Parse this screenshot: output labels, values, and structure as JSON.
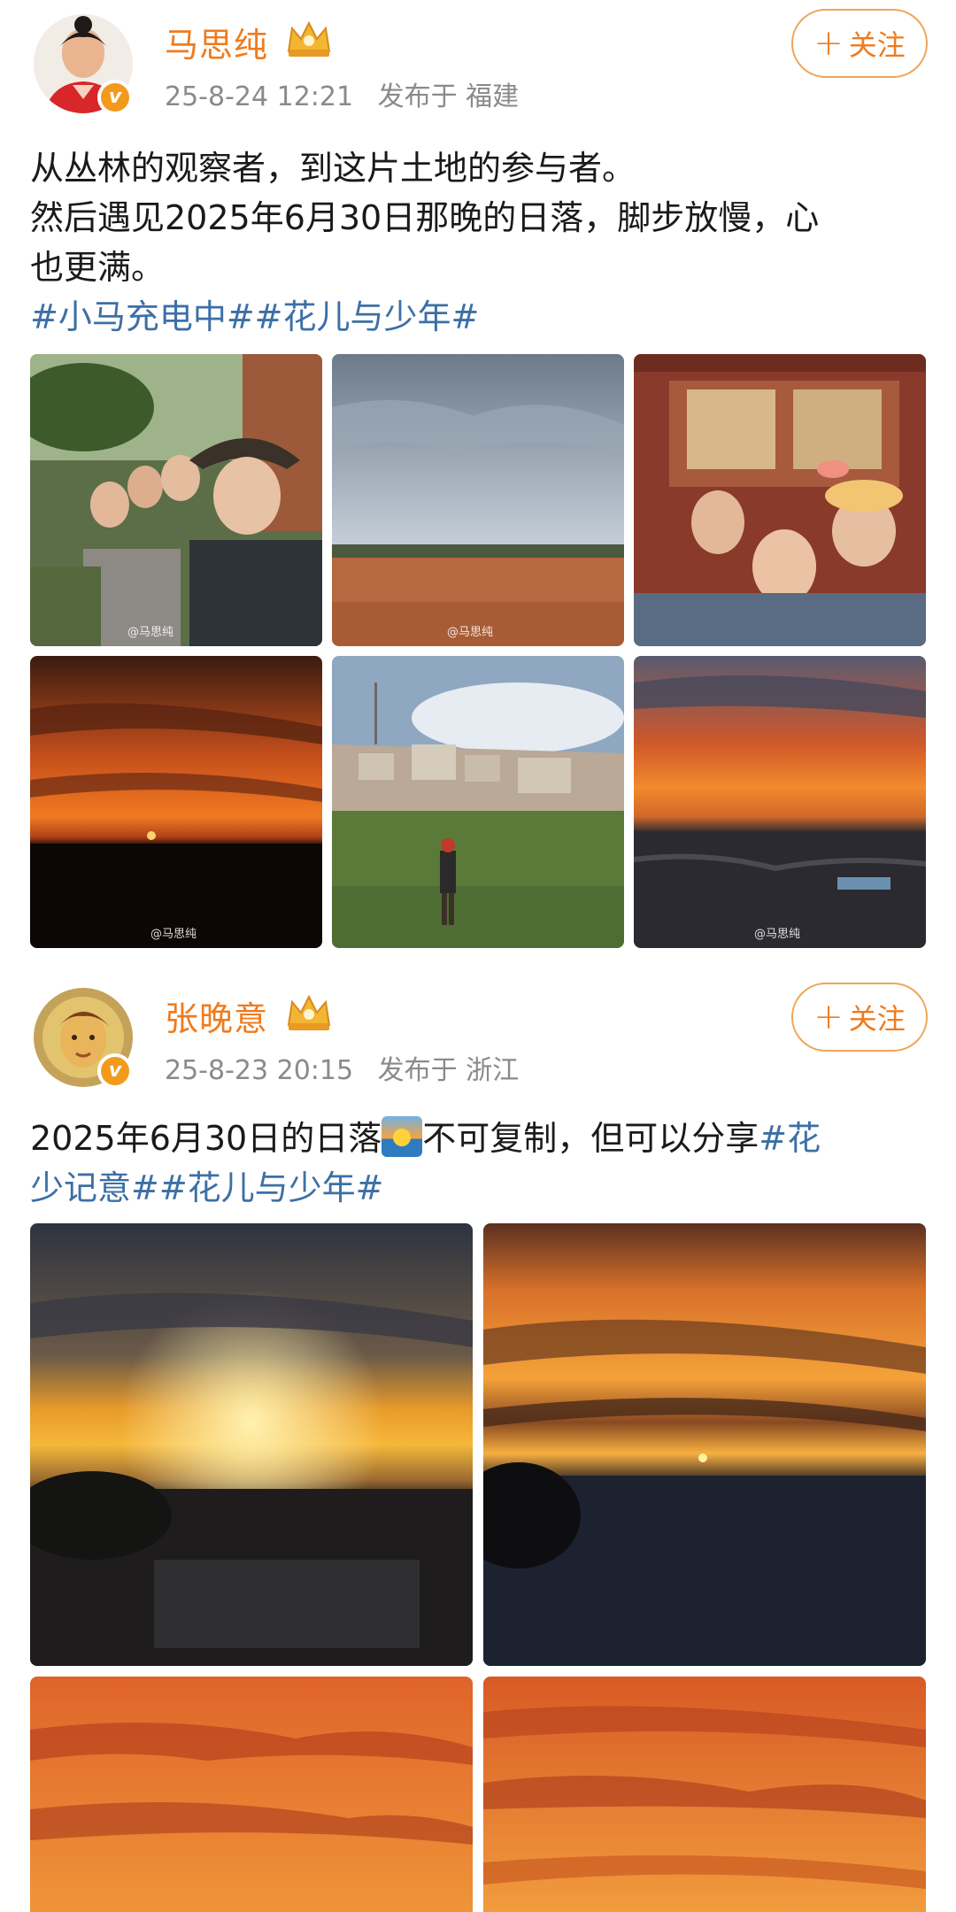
{
  "posts": [
    {
      "username": "马思纯",
      "time": "25-8-24 12:21",
      "location": "发布于 福建",
      "follow_label": "关注",
      "text_lines": [
        "从丛林的观察者，到这片土地的参与者。",
        "然后遇见2025年6月30日那晚的日落，脚步放慢，心",
        "也更满。"
      ],
      "hashtags": "#小马充电中##花儿与少年#",
      "watermark": "@马思纯",
      "photos": [
        "group-selfie-jungle",
        "red-field-landscape",
        "group-selfie-balcony",
        "orange-sunset-horizon",
        "hillside-town-runner",
        "sunset-over-city"
      ]
    },
    {
      "username": "张晚意",
      "time": "25-8-23 20:15",
      "location": "发布于 浙江",
      "follow_label": "关注",
      "text_part1": "2025年6月30日的日落",
      "emoji": "sunrise-emoji",
      "text_part2": "不可复制，但可以分享",
      "hashtags_line1": "#花",
      "hashtags_line2": "少记意##花儿与少年#",
      "photos": [
        "sunset-sunburst-city",
        "sunset-clouds-city",
        "orange-cloud-sky",
        "orange-cloud-sky-2"
      ]
    }
  ],
  "colors": {
    "username": "#ef7b1d",
    "hashtag": "#3d6fa6",
    "meta": "#8a8a8a",
    "follow_border": "#f0a458"
  }
}
